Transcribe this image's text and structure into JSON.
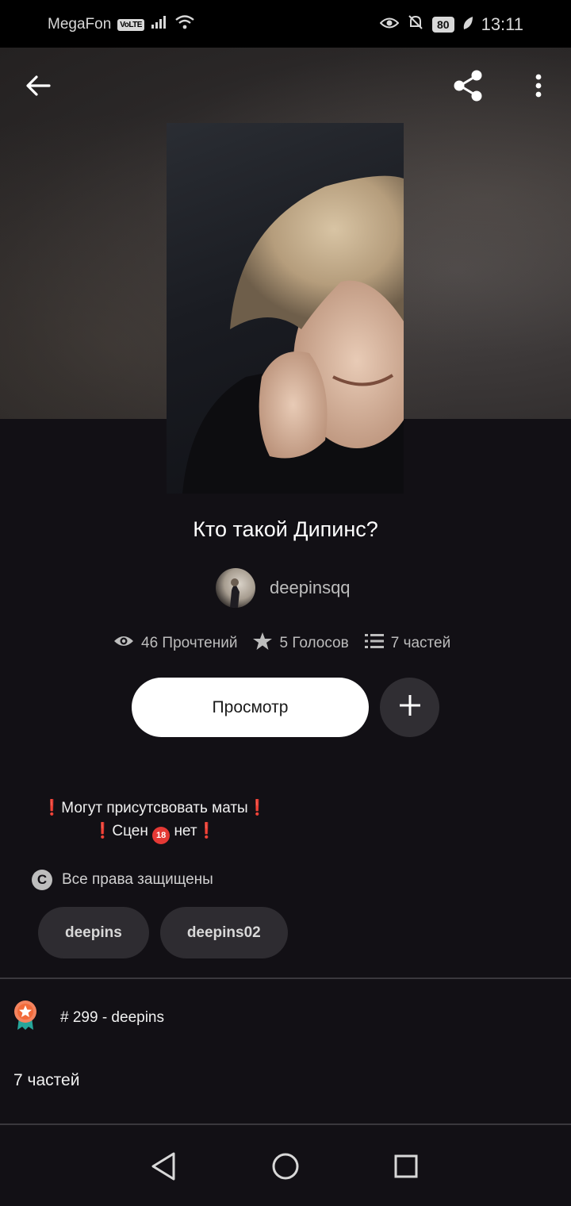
{
  "status_bar": {
    "carrier": "MegaFon",
    "volte": "VoLTE",
    "battery": "80",
    "time": "13:11"
  },
  "icons": {
    "back": "back-arrow-icon",
    "share": "share-icon",
    "more": "more-vert-icon"
  },
  "story": {
    "title": "Кто такой Дипинс?",
    "author": "deepinsqq",
    "reads": "46 Прочтений",
    "votes": "5 Голосов",
    "parts": "7 частей"
  },
  "actions": {
    "read_label": "Просмотр"
  },
  "description": {
    "line1_text": "Могут присутсвовать маты",
    "line2_text_a": "Сцен",
    "line2_age": "18",
    "line2_text_b": "нет",
    "excl": "❗"
  },
  "copyright": {
    "symbol": "C",
    "label": "Все права защищены"
  },
  "tags": [
    "deepins",
    "deepins02"
  ],
  "rank": {
    "label": "# 299 - deepins"
  },
  "parts_header": "7 частей"
}
